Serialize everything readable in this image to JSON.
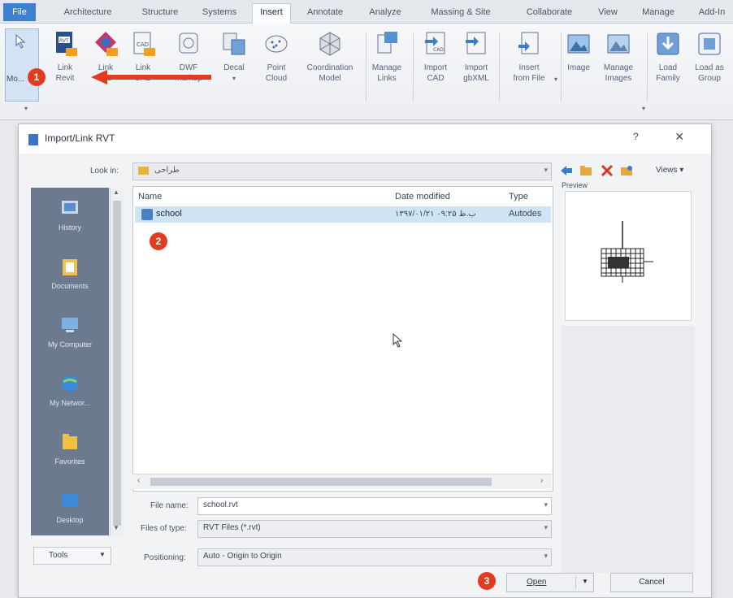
{
  "ribbon": {
    "tabs": [
      "File",
      "Architecture",
      "Structure",
      "Systems",
      "Insert",
      "Annotate",
      "Analyze",
      "Massing & Site",
      "Collaborate",
      "View",
      "Manage",
      "Add-In"
    ],
    "active_tab": "Insert",
    "modify_label": "Mo...",
    "buttons": [
      {
        "label": "Link\nRevit"
      },
      {
        "label": "Link\nIFC"
      },
      {
        "label": "Link\nCAD"
      },
      {
        "label": "DWF\nMarkup"
      },
      {
        "label": "Decal"
      },
      {
        "label": "Point\nCloud"
      },
      {
        "label": "Coordination\nModel"
      },
      {
        "label": "Manage\nLinks"
      },
      {
        "label": "Import\nCAD"
      },
      {
        "label": "Import\ngbXML"
      },
      {
        "label": "Insert\nfrom File"
      },
      {
        "label": "Image"
      },
      {
        "label": "Manage\nImages"
      },
      {
        "label": "Load\nFamily"
      },
      {
        "label": "Load as\nGroup"
      }
    ]
  },
  "annotations": {
    "step1": "1",
    "step2": "2",
    "step3": "3",
    "accent": "#e33a22"
  },
  "dialog": {
    "title": "Import/Link RVT",
    "help": "?",
    "close": "×",
    "look_in_label": "Look in:",
    "look_in_value": "طراحی",
    "views_label": "Views",
    "places": [
      "History",
      "Documents",
      "My Computer",
      "My Networ...",
      "Favorites",
      "Desktop"
    ],
    "columns": {
      "name": "Name",
      "date": "Date modified",
      "type": "Type"
    },
    "files": [
      {
        "name": "school",
        "date": "۱۳۹۷/۰۱/۲۱ ب.ظ ۰۹:۲۵",
        "type": "Autodes"
      }
    ],
    "preview_label": "Preview",
    "file_name_label": "File name:",
    "file_name_value": "school.rvt",
    "file_type_label": "Files of type:",
    "file_type_value": "RVT Files (*.rvt)",
    "positioning_label": "Positioning:",
    "positioning_value": "Auto - Origin to Origin",
    "tools_label": "Tools",
    "open_label": "Open",
    "cancel_label": "Cancel"
  }
}
